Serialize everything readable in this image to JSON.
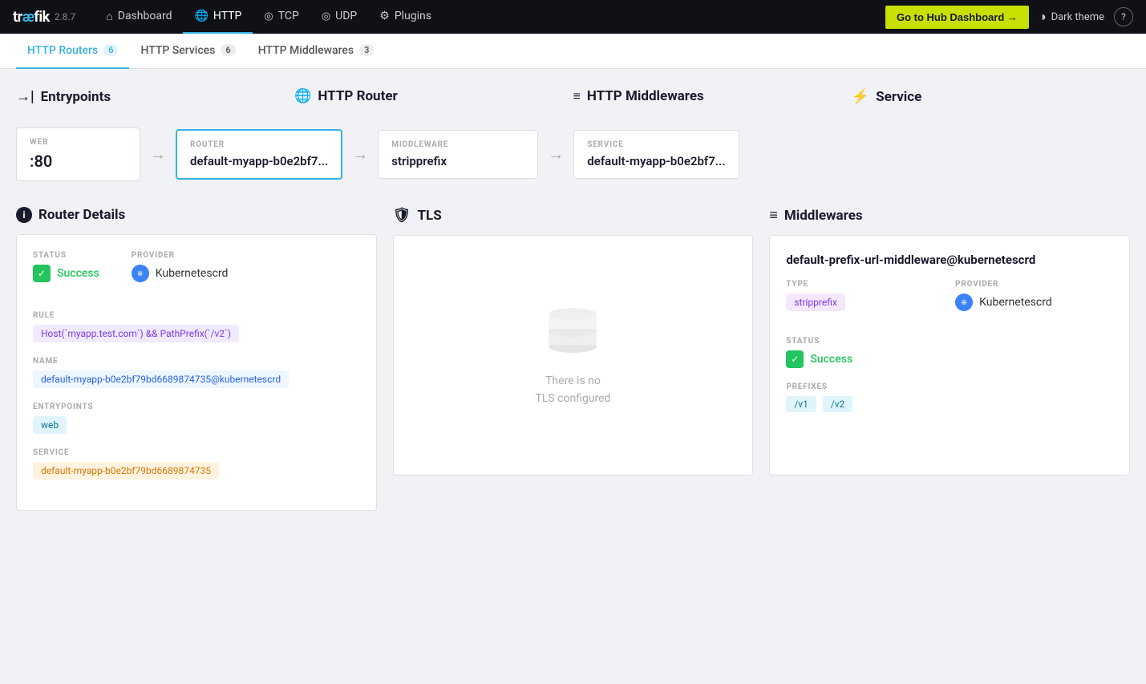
{
  "app": {
    "name": "træfik",
    "version": "2.8.7"
  },
  "topnav": {
    "items": [
      {
        "id": "dashboard",
        "label": "Dashboard",
        "icon": "home"
      },
      {
        "id": "http",
        "label": "HTTP",
        "icon": "globe",
        "active": true
      },
      {
        "id": "tcp",
        "label": "TCP",
        "icon": "circle"
      },
      {
        "id": "udp",
        "label": "UDP",
        "icon": "circle"
      },
      {
        "id": "plugins",
        "label": "Plugins",
        "icon": "puzzle"
      }
    ],
    "hub_button": "Go to Hub Dashboard →",
    "theme_label": "Dark theme",
    "help_label": "?"
  },
  "subtabs": [
    {
      "id": "routers",
      "label": "HTTP Routers",
      "count": "6",
      "active": true
    },
    {
      "id": "services",
      "label": "HTTP Services",
      "count": "6",
      "active": false
    },
    {
      "id": "middlewares",
      "label": "HTTP Middlewares",
      "count": "3",
      "active": false
    }
  ],
  "flow": {
    "col1": {
      "header": "Entrypoints",
      "card_label": "WEB",
      "card_value": ":80"
    },
    "col2": {
      "header": "HTTP Router",
      "card_label": "ROUTER",
      "card_value": "default-myapp-b0e2bf7...",
      "highlighted": true
    },
    "col3": {
      "header": "HTTP Middlewares",
      "card_label": "MIDDLEWARE",
      "card_value": "stripprefix"
    },
    "col4": {
      "header": "Service",
      "card_label": "SERVICE",
      "card_value": "default-myapp-b0e2bf7..."
    }
  },
  "router_details": {
    "section_title": "Router Details",
    "status_label": "STATUS",
    "status_value": "Success",
    "provider_label": "PROVIDER",
    "provider_value": "Kubernetescrd",
    "rule_label": "RULE",
    "rule_value": "Host(`myapp.test.com`) && PathPrefix(`/v2`)",
    "name_label": "NAME",
    "name_value": "default-myapp-b0e2bf79bd6689874735@kubernetescrd",
    "entrypoints_label": "ENTRYPOINTS",
    "entrypoints_value": "web",
    "service_label": "SERVICE",
    "service_value": "default-myapp-b0e2bf79bd6689874735"
  },
  "tls": {
    "section_title": "TLS",
    "empty_text": "There is no\nTLS configured"
  },
  "middlewares": {
    "section_title": "Middlewares",
    "mw_name": "default-prefix-url-middleware@kubernetescrd",
    "type_label": "TYPE",
    "type_value": "stripprefix",
    "provider_label": "PROVIDER",
    "provider_value": "Kubernetescrd",
    "status_label": "STATUS",
    "status_value": "Success",
    "prefixes_label": "PREFIXES",
    "prefixes": [
      "/v1",
      "/v2"
    ]
  }
}
